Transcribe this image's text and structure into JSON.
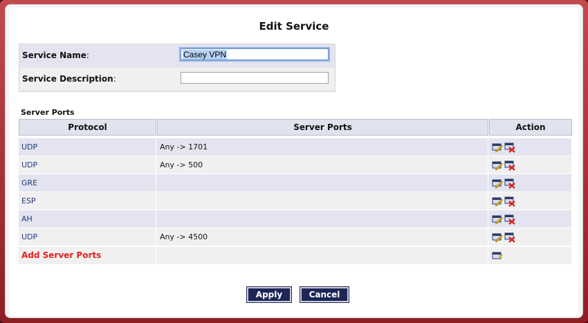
{
  "title": "Edit Service",
  "form": {
    "service_name_label": "Service Name",
    "service_name_value": "Casey VPN",
    "service_description_label": "Service Description",
    "service_description_value": ""
  },
  "server_ports": {
    "section_title": "Server Ports",
    "columns": [
      "Protocol",
      "Server Ports",
      "Action"
    ],
    "rows": [
      {
        "protocol": "UDP",
        "ports": "Any -> 1701"
      },
      {
        "protocol": "UDP",
        "ports": "Any -> 500"
      },
      {
        "protocol": "GRE",
        "ports": ""
      },
      {
        "protocol": "ESP",
        "ports": ""
      },
      {
        "protocol": "AH",
        "ports": ""
      },
      {
        "protocol": "UDP",
        "ports": "Any -> 4500"
      }
    ],
    "add_label": "Add Server Ports"
  },
  "buttons": {
    "apply": "Apply",
    "cancel": "Cancel"
  },
  "icons": {
    "edit": "edit-icon",
    "delete": "delete-icon",
    "add": "add-icon"
  },
  "colors": {
    "frame": "#a8282d",
    "header_bg": "#e0e2ee",
    "button_bg": "#1d2656",
    "add_link": "#e8201c",
    "link": "#1f3a77"
  }
}
